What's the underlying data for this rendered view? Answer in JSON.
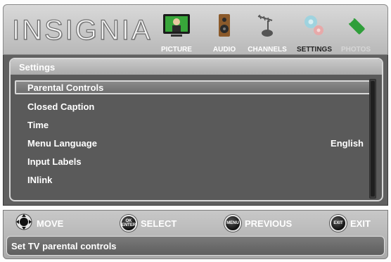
{
  "brand": {
    "logo_text": "INSIGNIA"
  },
  "tabs": [
    {
      "label": "PICTURE",
      "icon": "tv-picture-icon",
      "state": "normal"
    },
    {
      "label": "AUDIO",
      "icon": "speaker-icon",
      "state": "normal"
    },
    {
      "label": "CHANNELS",
      "icon": "antenna-icon",
      "state": "normal"
    },
    {
      "label": "SETTINGS",
      "icon": "gears-icon",
      "state": "active"
    },
    {
      "label": "PHOTOS",
      "icon": "usb-drive-icon",
      "state": "disabled"
    }
  ],
  "panel": {
    "title": "Settings",
    "items": [
      {
        "label": "Parental Controls",
        "value": "",
        "selected": true
      },
      {
        "label": "Closed Caption",
        "value": ""
      },
      {
        "label": "Time",
        "value": ""
      },
      {
        "label": "Menu Language",
        "value": "English"
      },
      {
        "label": "Input Labels",
        "value": ""
      },
      {
        "label": "INlink",
        "value": ""
      }
    ]
  },
  "footer": {
    "hints": [
      {
        "button": "",
        "icon": "dpad-icon",
        "label": "MOVE"
      },
      {
        "button": "OK ENTER",
        "icon": "ok-enter-button-icon",
        "label": "SELECT"
      },
      {
        "button": "MENU",
        "icon": "menu-button-icon",
        "label": "PREVIOUS"
      },
      {
        "button": "EXIT",
        "icon": "exit-button-icon",
        "label": "EXIT"
      }
    ],
    "status_text": "Set TV parental controls"
  },
  "colors": {
    "panel_bg": "#5a5a5a",
    "header_bg": "#c8c8c8",
    "selected_border": "#d8d8d8",
    "tab_label_active": "#222222",
    "tab_label_disabled": "#d6d6d6"
  }
}
